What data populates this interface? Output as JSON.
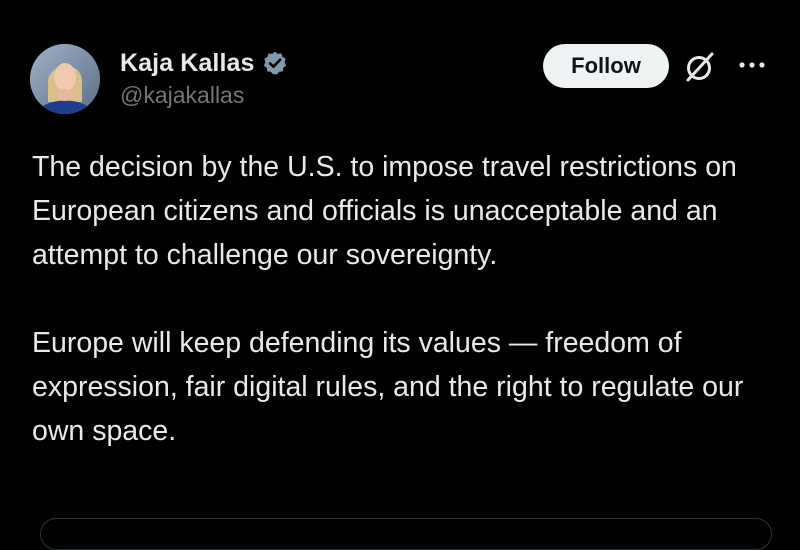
{
  "author": {
    "display_name": "Kaja Kallas",
    "handle": "@kajakallas",
    "verified_icon": "verified-badge-icon",
    "avatar_icon": "avatar"
  },
  "actions": {
    "follow_label": "Follow",
    "grok_icon": "grok-icon",
    "more_icon": "more-options-icon"
  },
  "tweet": {
    "paragraphs": [
      "The decision by the U.S. to impose travel restrictions on European citizens and officials is unacceptable and an attempt to challenge our sovereignty.",
      "Europe will keep defending its values — freedom of expression, fair digital rules, and the right to regulate our own space."
    ]
  },
  "colors": {
    "background": "#000000",
    "primary_text": "#e7e9ea",
    "secondary_text": "#71767b",
    "follow_bg": "#eff3f4",
    "verified_badge": "#829aab"
  }
}
